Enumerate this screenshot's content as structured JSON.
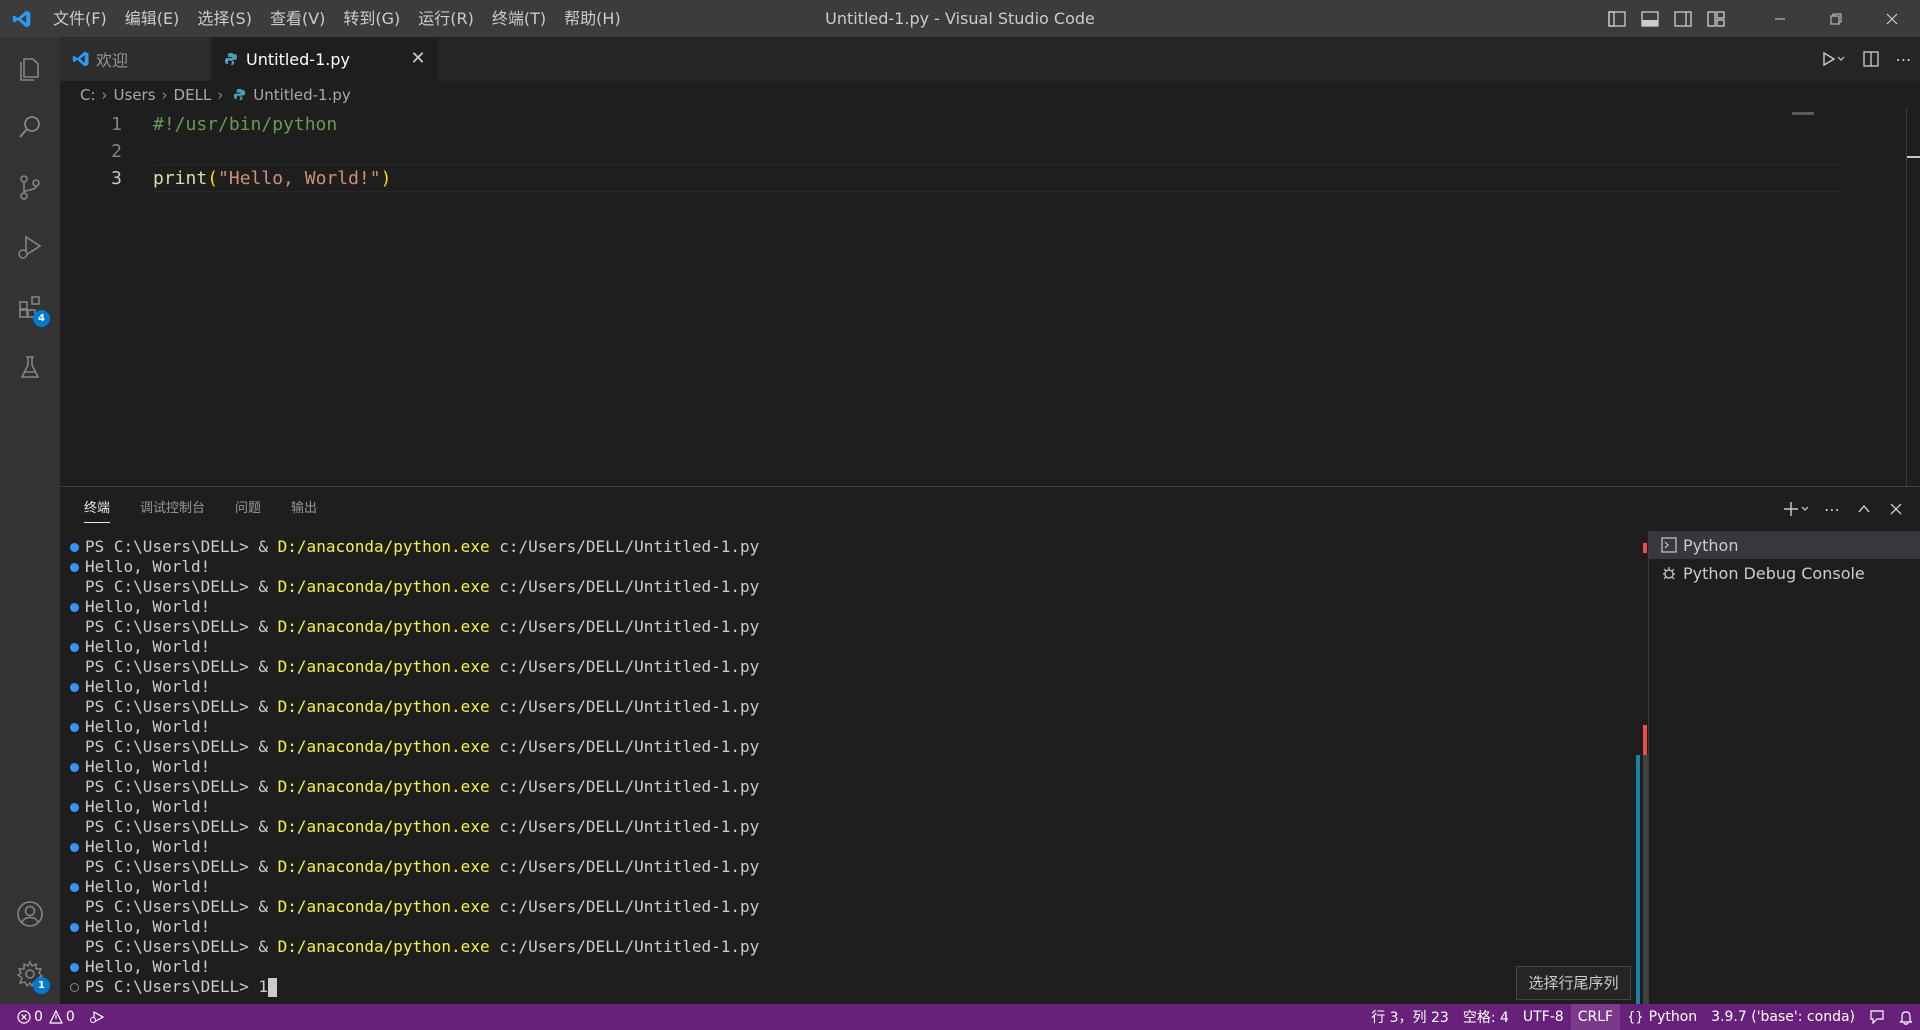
{
  "titlebar": {
    "menu": [
      "文件(F)",
      "编辑(E)",
      "选择(S)",
      "查看(V)",
      "转到(G)",
      "运行(R)",
      "终端(T)",
      "帮助(H)"
    ],
    "window_title": "Untitled-1.py - Visual Studio Code"
  },
  "activity_bar": {
    "items": [
      "explorer-icon",
      "search-icon",
      "source-control-icon",
      "run-debug-icon",
      "extensions-icon",
      "testing-icon"
    ],
    "extensions_badge": "4",
    "bottom": [
      "accounts-icon",
      "manage-gear-icon"
    ],
    "settings_badge": "1"
  },
  "tabs": [
    {
      "label": "欢迎",
      "active": false
    },
    {
      "label": "Untitled-1.py",
      "active": true
    }
  ],
  "breadcrumb": {
    "drive": "C:",
    "users": "Users",
    "user": "DELL",
    "file": "Untitled-1.py"
  },
  "editor": {
    "lines": [
      {
        "number": "1",
        "text": "#!/usr/bin/python"
      },
      {
        "number": "2",
        "text": ""
      },
      {
        "number": "3",
        "fn": "print",
        "open": "(",
        "string": "\"Hello, World!\"",
        "close": ")"
      }
    ]
  },
  "panel": {
    "tabs": [
      "终端",
      "调试控制台",
      "问题",
      "输出"
    ],
    "active_tab": "终端",
    "terminal": {
      "prompt": "PS C:\\Users\\DELL> ",
      "amp": "& ",
      "exe": "D:/anaconda/python.exe",
      "arg": " c:/Users/DELL/Untitled-1.py",
      "output": "Hello, World!",
      "run_count": 11,
      "last_input": "1"
    },
    "terminal_list": [
      "Python",
      "Python Debug Console"
    ]
  },
  "tooltip": "选择行尾序列",
  "statusbar": {
    "errors": "0",
    "warnings": "0",
    "position": "行 3，列 23",
    "spaces": "空格: 4",
    "encoding": "UTF-8",
    "eol": "CRLF",
    "language": "Python",
    "interpreter": "3.9.7 ('base': conda)"
  },
  "colors": {
    "statusbar": "#68217a",
    "titlebar": "#3c3c3c",
    "activity_bar": "#333333",
    "editor_bg": "#1e1e1e",
    "accent": "#007acc",
    "comment": "#6a9955",
    "string": "#ce9178",
    "function": "#dcdcaa",
    "terminal_yellow": "#f5f543"
  }
}
